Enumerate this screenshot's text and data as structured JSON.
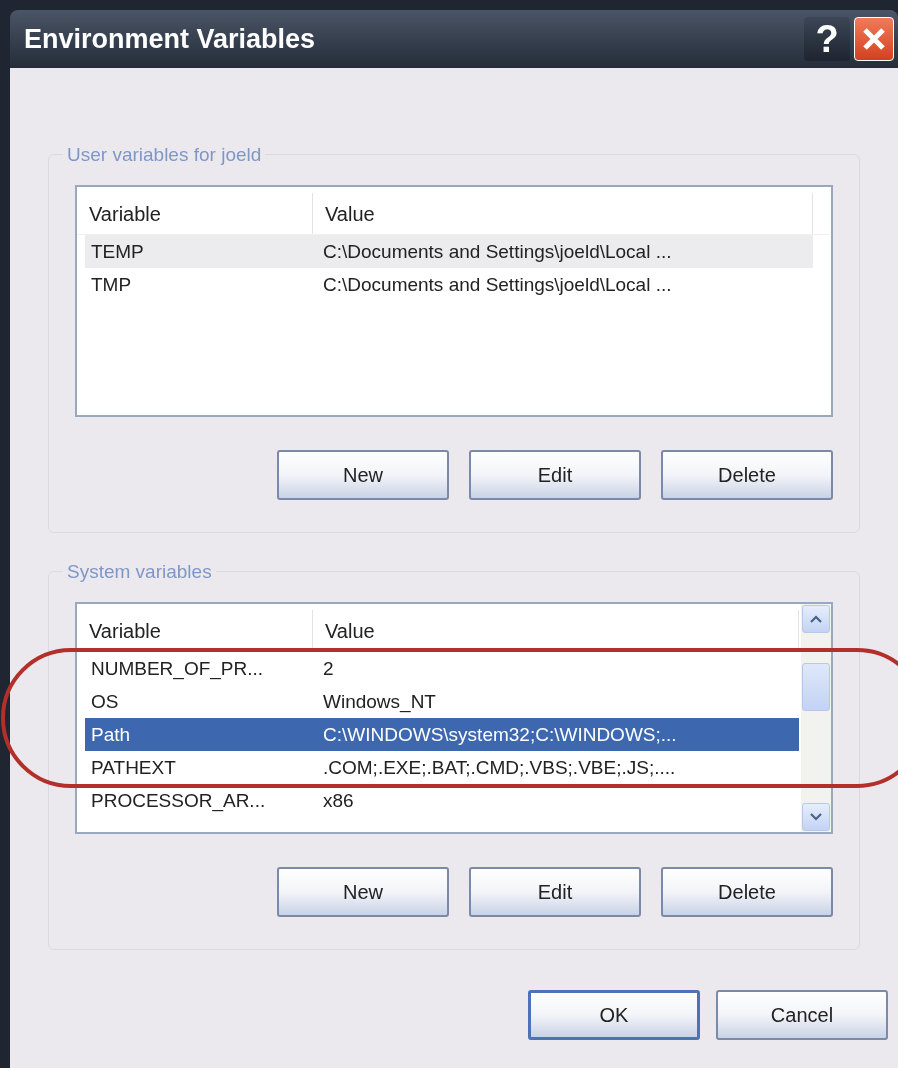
{
  "window": {
    "title": "Environment Variables",
    "title_buttons": [
      {
        "kind": "help",
        "label": "?"
      },
      {
        "kind": "close"
      }
    ]
  },
  "groups": [
    {
      "title": "User variables for joeld",
      "list": {
        "focused": false,
        "scrollbar": false,
        "columns": [
          "Variable",
          "Value"
        ],
        "rows": [
          {
            "variable": "TEMP",
            "value": "C:\\Documents and Settings\\joeld\\Local ...",
            "selected": true
          },
          {
            "variable": "TMP",
            "value": "C:\\Documents and Settings\\joeld\\Local ...",
            "selected": false
          }
        ]
      },
      "buttons": [
        "New",
        "Edit",
        "Delete"
      ]
    },
    {
      "title": "System variables",
      "list": {
        "focused": true,
        "scrollbar": true,
        "columns": [
          "Variable",
          "Value"
        ],
        "rows": [
          {
            "variable": "NUMBER_OF_PR...",
            "value": "2",
            "selected": false
          },
          {
            "variable": "OS",
            "value": "Windows_NT",
            "selected": false
          },
          {
            "variable": "Path",
            "value": "C:\\WINDOWS\\system32;C:\\WINDOWS;...",
            "selected": true
          },
          {
            "variable": "PATHEXT",
            "value": ".COM;.EXE;.BAT;.CMD;.VBS;.VBE;.JS;....",
            "selected": false
          },
          {
            "variable": "PROCESSOR_AR...",
            "value": "x86",
            "selected": false
          }
        ]
      },
      "buttons": [
        "New",
        "Edit",
        "Delete"
      ]
    }
  ],
  "annotation": {
    "kind": "ellipse",
    "color": "#b3302a"
  },
  "dialog_buttons": [
    {
      "label": "OK",
      "default": true
    },
    {
      "label": "Cancel",
      "default": false
    }
  ]
}
